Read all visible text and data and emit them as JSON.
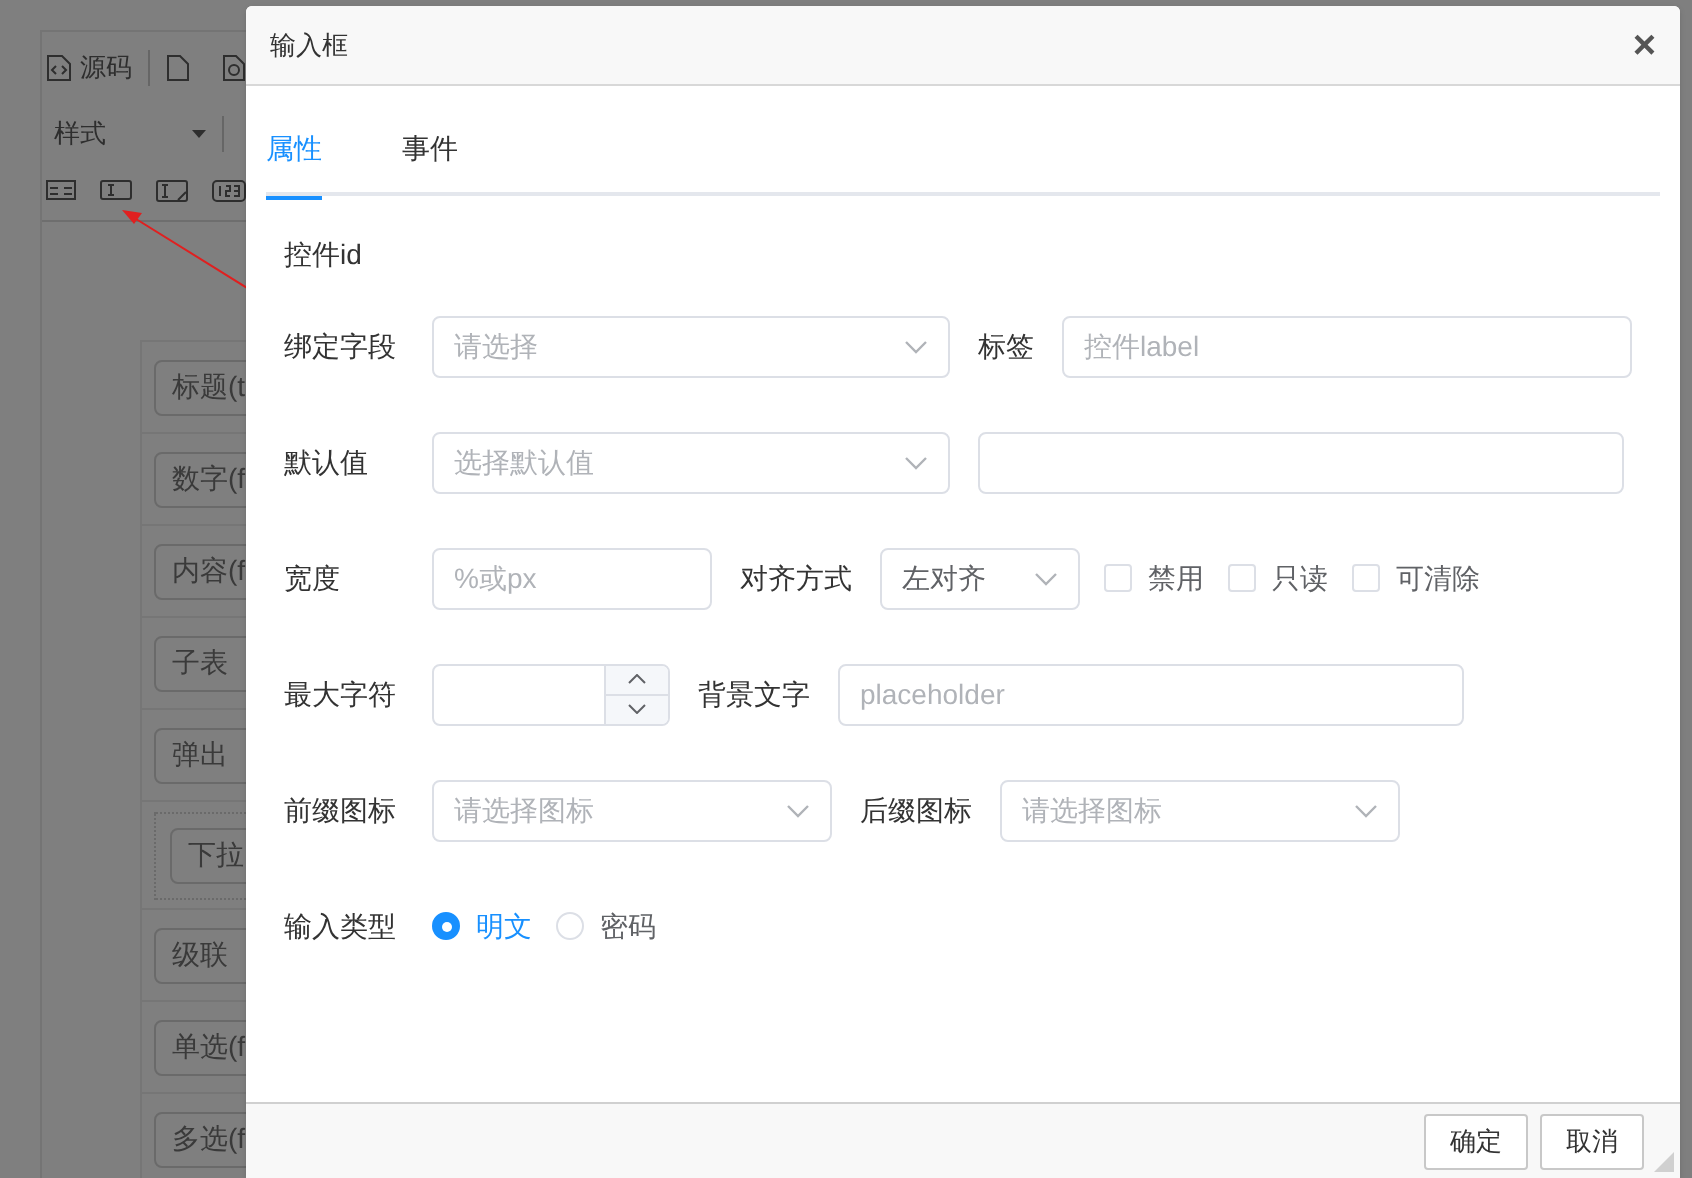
{
  "editor": {
    "source_button": "源码",
    "style_dropdown": "样式",
    "fields": [
      {
        "kind": "field",
        "label": "标题(t"
      },
      {
        "kind": "field",
        "label": "数字(f"
      },
      {
        "kind": "field",
        "label": "内容(f"
      },
      {
        "kind": "field",
        "label": "子表"
      },
      {
        "kind": "field",
        "label": "弹出"
      },
      {
        "kind": "grouped",
        "label": "下拉"
      },
      {
        "kind": "field",
        "label": "级联"
      },
      {
        "kind": "field",
        "label": "单选(f"
      },
      {
        "kind": "field",
        "label": "多选(f"
      }
    ]
  },
  "dialog": {
    "title": "输入框",
    "close": "×",
    "tabs": [
      {
        "label": "属性",
        "selected": true
      },
      {
        "label": "事件",
        "selected": false
      }
    ],
    "control_id_label": "控件id",
    "form": [
      {
        "fields": [
          {
            "label": "绑定字段",
            "kind": "select",
            "placeholder": "请选择"
          },
          {
            "label": "标签",
            "kind": "input",
            "placeholder": "控件label"
          }
        ]
      },
      {
        "fields": [
          {
            "label": "默认值",
            "kind": "select",
            "placeholder": "选择默认值"
          },
          {
            "kind": "input"
          }
        ]
      },
      {
        "fields": [
          {
            "label": "宽度",
            "kind": "input",
            "placeholder": "%或px"
          },
          {
            "label": "对齐方式",
            "kind": "select",
            "value": "左对齐"
          },
          {
            "kind": "checkbox",
            "text": "禁用",
            "checked": false
          },
          {
            "kind": "checkbox",
            "text": "只读",
            "checked": false
          },
          {
            "kind": "checkbox",
            "text": "可清除",
            "checked": false
          }
        ]
      },
      {
        "fields": [
          {
            "label": "最大字符",
            "kind": "number"
          },
          {
            "label": "背景文字",
            "kind": "input",
            "placeholder": "placeholder"
          }
        ]
      },
      {
        "fields": [
          {
            "label": "前缀图标",
            "kind": "select",
            "placeholder": "请选择图标"
          },
          {
            "label": "后缀图标",
            "kind": "select",
            "placeholder": "请选择图标"
          }
        ]
      },
      {
        "fields": [
          {
            "label": "输入类型",
            "kind": "radio_group",
            "options": [
              {
                "text": "明文",
                "selected": true
              },
              {
                "text": "密码",
                "selected": false
              }
            ]
          }
        ]
      }
    ],
    "buttons": [
      "确定",
      "取消"
    ]
  }
}
